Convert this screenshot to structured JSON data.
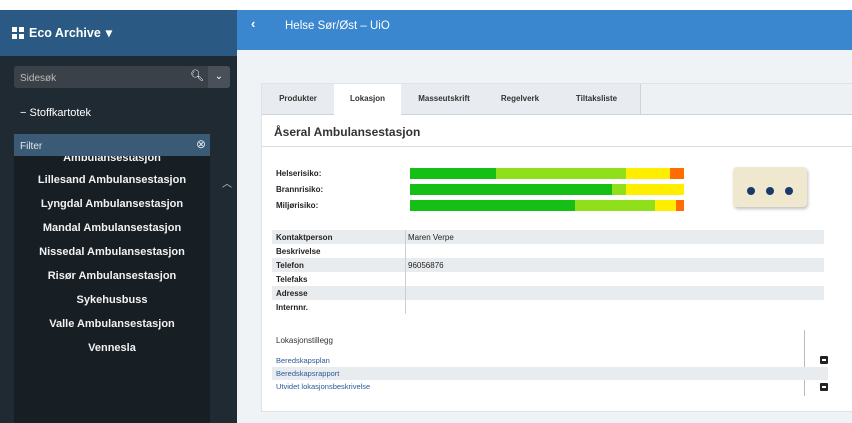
{
  "sidebar": {
    "brand": "Eco Archive",
    "search_placeholder": "Sidesøk",
    "section": "Stoffkartotek",
    "filter_placeholder": "Filter",
    "items": [
      "Ambulansestasjon",
      "Lillesand Ambulansestasjon",
      "Lyngdal Ambulansestasjon",
      "Mandal Ambulansestasjon",
      "Nissedal Ambulansestasjon",
      "Risør Ambulansestasjon",
      "Sykehusbuss",
      "Valle Ambulansestasjon",
      "Vennesla"
    ]
  },
  "header": {
    "title": "Helse Sør/Øst – UiO"
  },
  "tabs": [
    "Produkter",
    "Lokasjon",
    "Masseutskrift",
    "Regelverk",
    "Tiltaksliste"
  ],
  "active_tab": "Lokasjon",
  "location": {
    "title": "Åseral Ambulansestasjon",
    "risks": [
      {
        "label": "Helserisiko:"
      },
      {
        "label": "Brannrisiko:"
      },
      {
        "label": "Miljørisiko:"
      }
    ],
    "info": [
      {
        "key": "Kontaktperson",
        "value": "Maren Verpe"
      },
      {
        "key": "Beskrivelse",
        "value": ""
      },
      {
        "key": "Telefon",
        "value": "96056876"
      },
      {
        "key": "Telefaks",
        "value": ""
      },
      {
        "key": "Adresse",
        "value": ""
      },
      {
        "key": "Internnr.",
        "value": ""
      }
    ],
    "tillegg_title": "Lokasjonstillegg",
    "tillegg": [
      "Beredskapsplan",
      "Beredskapsrapport",
      "Utvidet lokasjonsbeskrivelse"
    ]
  },
  "colors": {
    "dark_green": "#16bf16",
    "light_green": "#8fe01a",
    "yellow": "#ffee00",
    "orange": "#ff6d00"
  }
}
